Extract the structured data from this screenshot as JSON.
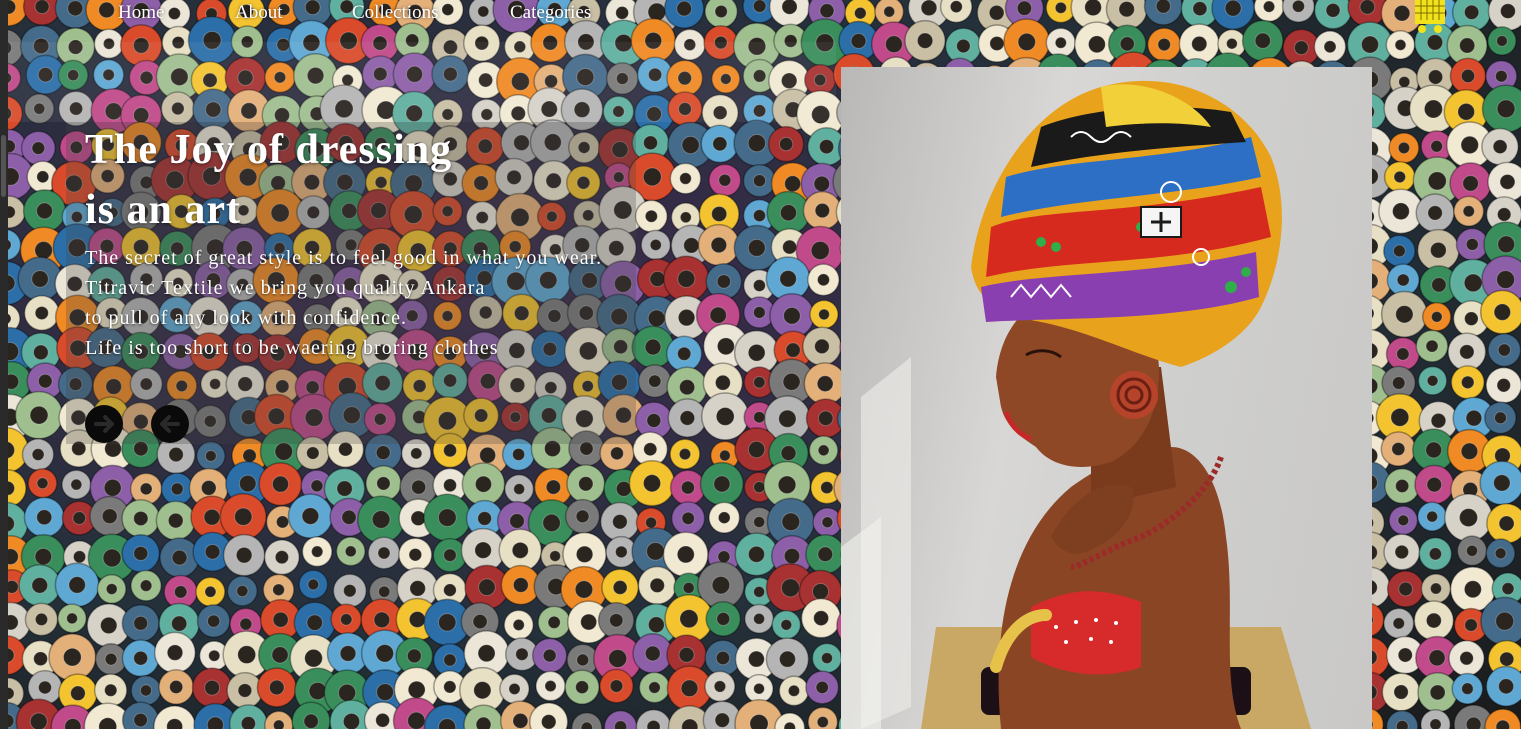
{
  "nav": {
    "items": [
      "Home",
      "About",
      "Collections",
      "Categories"
    ]
  },
  "hero": {
    "title_line1": "The Joy of dressing",
    "title_line2": "is an art",
    "lines": [
      "The secret of great style is to feel good in what you wear.",
      "Titravic Textile we bring you quality Ankara",
      "to pull of any look with confidence.",
      "Life is too short to be waering broring clothes"
    ]
  },
  "icons": {
    "cart": "shopping-cart-icon",
    "next": "arrow-right-icon",
    "prev": "arrow-left-icon"
  },
  "colors": {
    "text": "#ffffff",
    "cart": "#f2e21b",
    "arrow_bg": "#0a0a0a"
  }
}
